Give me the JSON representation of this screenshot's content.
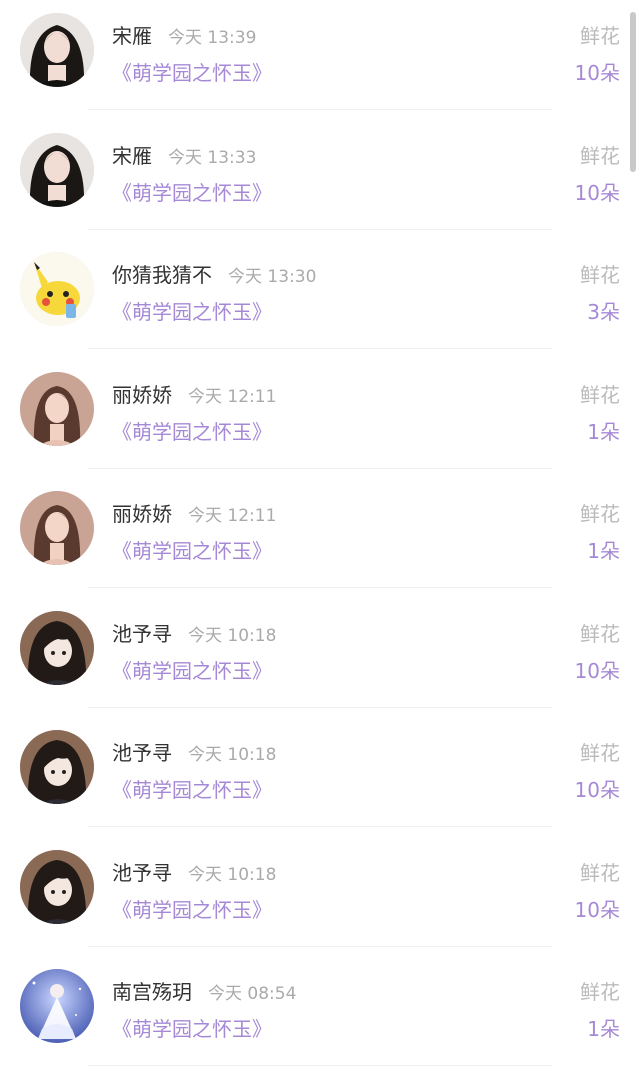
{
  "items": [
    {
      "name": "宋雁",
      "time": "今天 13:39",
      "book": "《萌学园之怀玉》",
      "gift": "鲜花",
      "count": "10朵",
      "avatar": "woman-dark-hair-avatar"
    },
    {
      "name": "宋雁",
      "time": "今天 13:33",
      "book": "《萌学园之怀玉》",
      "gift": "鲜花",
      "count": "10朵",
      "avatar": "woman-dark-hair-avatar"
    },
    {
      "name": "你猜我猜不",
      "time": "今天 13:30",
      "book": "《萌学园之怀玉》",
      "gift": "鲜花",
      "count": "3朵",
      "avatar": "pikachu-avatar"
    },
    {
      "name": "丽娇娇",
      "time": "今天 12:11",
      "book": "《萌学园之怀玉》",
      "gift": "鲜花",
      "count": "1朵",
      "avatar": "woman-warm-tone-avatar"
    },
    {
      "name": "丽娇娇",
      "time": "今天 12:11",
      "book": "《萌学园之怀玉》",
      "gift": "鲜花",
      "count": "1朵",
      "avatar": "woman-warm-tone-avatar"
    },
    {
      "name": "池予寻",
      "time": "今天 10:18",
      "book": "《萌学园之怀玉》",
      "gift": "鲜花",
      "count": "10朵",
      "avatar": "anime-girl-avatar"
    },
    {
      "name": "池予寻",
      "time": "今天 10:18",
      "book": "《萌学园之怀玉》",
      "gift": "鲜花",
      "count": "10朵",
      "avatar": "anime-girl-avatar"
    },
    {
      "name": "池予寻",
      "time": "今天 10:18",
      "book": "《萌学园之怀玉》",
      "gift": "鲜花",
      "count": "10朵",
      "avatar": "anime-girl-avatar"
    },
    {
      "name": "南宫殇玥",
      "time": "今天 08:54",
      "book": "《萌学园之怀玉》",
      "gift": "鲜花",
      "count": "1朵",
      "avatar": "white-dress-avatar"
    }
  ],
  "colors": {
    "accent": "#a689d6",
    "name": "#333333",
    "muted": "#aaaaaa"
  }
}
